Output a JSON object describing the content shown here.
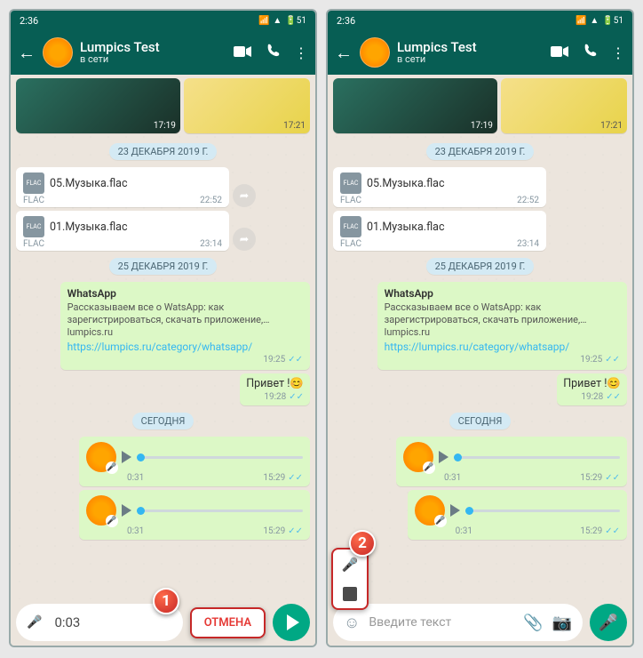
{
  "status_time": "2:36",
  "battery": "51",
  "contact": {
    "name": "Lumpics Test",
    "status": "в сети"
  },
  "media": [
    {
      "time": "17:19"
    },
    {
      "time": "17:21"
    },
    {
      "time": "17:19"
    },
    {
      "time": "17:21"
    }
  ],
  "date1": "23 ДЕКАБРЯ 2019 Г.",
  "files": [
    {
      "name": "05.Музыка.flac",
      "type": "FLAC",
      "time": "22:52"
    },
    {
      "name": "01.Музыка.flac",
      "type": "FLAC",
      "time": "23:14"
    }
  ],
  "date2": "25 ДЕКАБРЯ 2019 Г.",
  "link": {
    "title": "WhatsApp",
    "desc": "Рассказываем все о WatsApp: как зарегистрироваться, скачать приложение,…",
    "site": "lumpics.ru",
    "url": "https://lumpics.ru/category/whatsapp/",
    "time": "19:25"
  },
  "greet": {
    "text": "Привет !",
    "time": "19:28"
  },
  "date3": "СЕГОДНЯ",
  "voice": [
    {
      "dur": "0:31",
      "time": "15:29"
    },
    {
      "dur": "0:31",
      "time": "15:29"
    }
  ],
  "recording": {
    "timer": "0:03",
    "cancel": "ОТМЕНА"
  },
  "placeholder": "Введите текст",
  "callouts": {
    "one": "1",
    "two": "2"
  }
}
